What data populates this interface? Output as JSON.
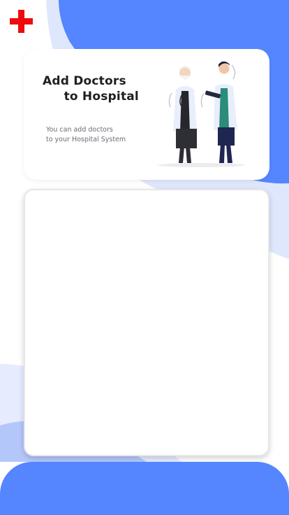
{
  "colors": {
    "accent": "#5585ff",
    "accent_light": "#c9d6fb",
    "background": "#ffffff",
    "logo_red": "#ef0b0b"
  },
  "logo": {
    "icon": "red-cross-icon"
  },
  "hero": {
    "title": "Add Doctors\n     to Hospital",
    "subtitle": "You can add doctors\nto your Hospital System",
    "illustration": "two-doctors-illustration"
  },
  "panel": {
    "content": ""
  }
}
